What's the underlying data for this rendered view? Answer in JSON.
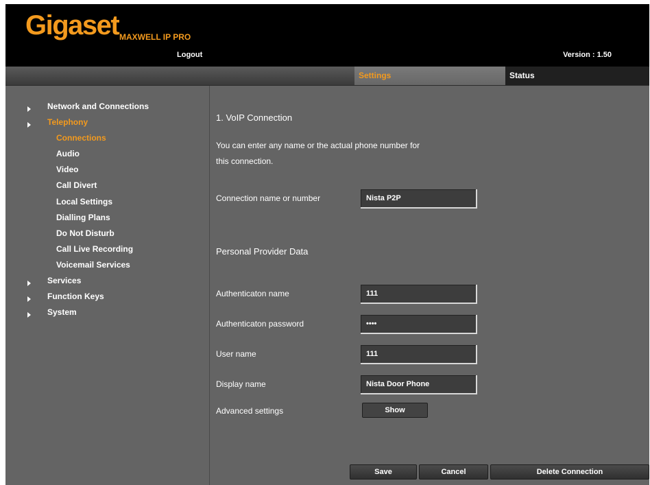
{
  "header": {
    "brand": "Gigaset",
    "model": "MAXWELL IP PRO",
    "logout": "Logout",
    "version": "Version : 1.50"
  },
  "tabs": [
    {
      "label": "Settings",
      "active": true
    },
    {
      "label": "Status",
      "active": false
    }
  ],
  "sidebar": {
    "items": [
      {
        "label": "Network and Connections",
        "level": 0
      },
      {
        "label": "Telephony",
        "level": 0,
        "active": true
      },
      {
        "label": "Connections",
        "level": 1,
        "active": true
      },
      {
        "label": "Audio",
        "level": 1
      },
      {
        "label": "Video",
        "level": 1
      },
      {
        "label": "Call Divert",
        "level": 1
      },
      {
        "label": "Local Settings",
        "level": 1
      },
      {
        "label": "Dialling Plans",
        "level": 1
      },
      {
        "label": "Do Not Disturb",
        "level": 1
      },
      {
        "label": "Call Live Recording",
        "level": 1
      },
      {
        "label": "Voicemail Services",
        "level": 1
      },
      {
        "label": "Services",
        "level": 0
      },
      {
        "label": "Function Keys",
        "level": 0
      },
      {
        "label": "System",
        "level": 0
      }
    ]
  },
  "main": {
    "title": "1. VoIP Connection",
    "intro_line1": "You can enter any name or the actual phone number for",
    "intro_line2": "this connection.",
    "connection_label": "Connection name or number",
    "connection_value": "Nista P2P",
    "section_title": "Personal Provider Data",
    "auth_name_label": "Authenticaton name",
    "auth_name_value": "111",
    "auth_password_label": "Authenticaton password",
    "auth_password_value": "1111",
    "user_name_label": "User name",
    "user_name_value": "111",
    "display_name_label": "Display name",
    "display_name_value": "Nista Door Phone",
    "advanced_label": "Advanced settings",
    "show_button": "Show"
  },
  "footer": {
    "save": "Save",
    "cancel": "Cancel",
    "delete": "Delete Connection"
  },
  "colors": {
    "accent": "#f39a1e",
    "panel": "#646464",
    "header": "#000000"
  }
}
